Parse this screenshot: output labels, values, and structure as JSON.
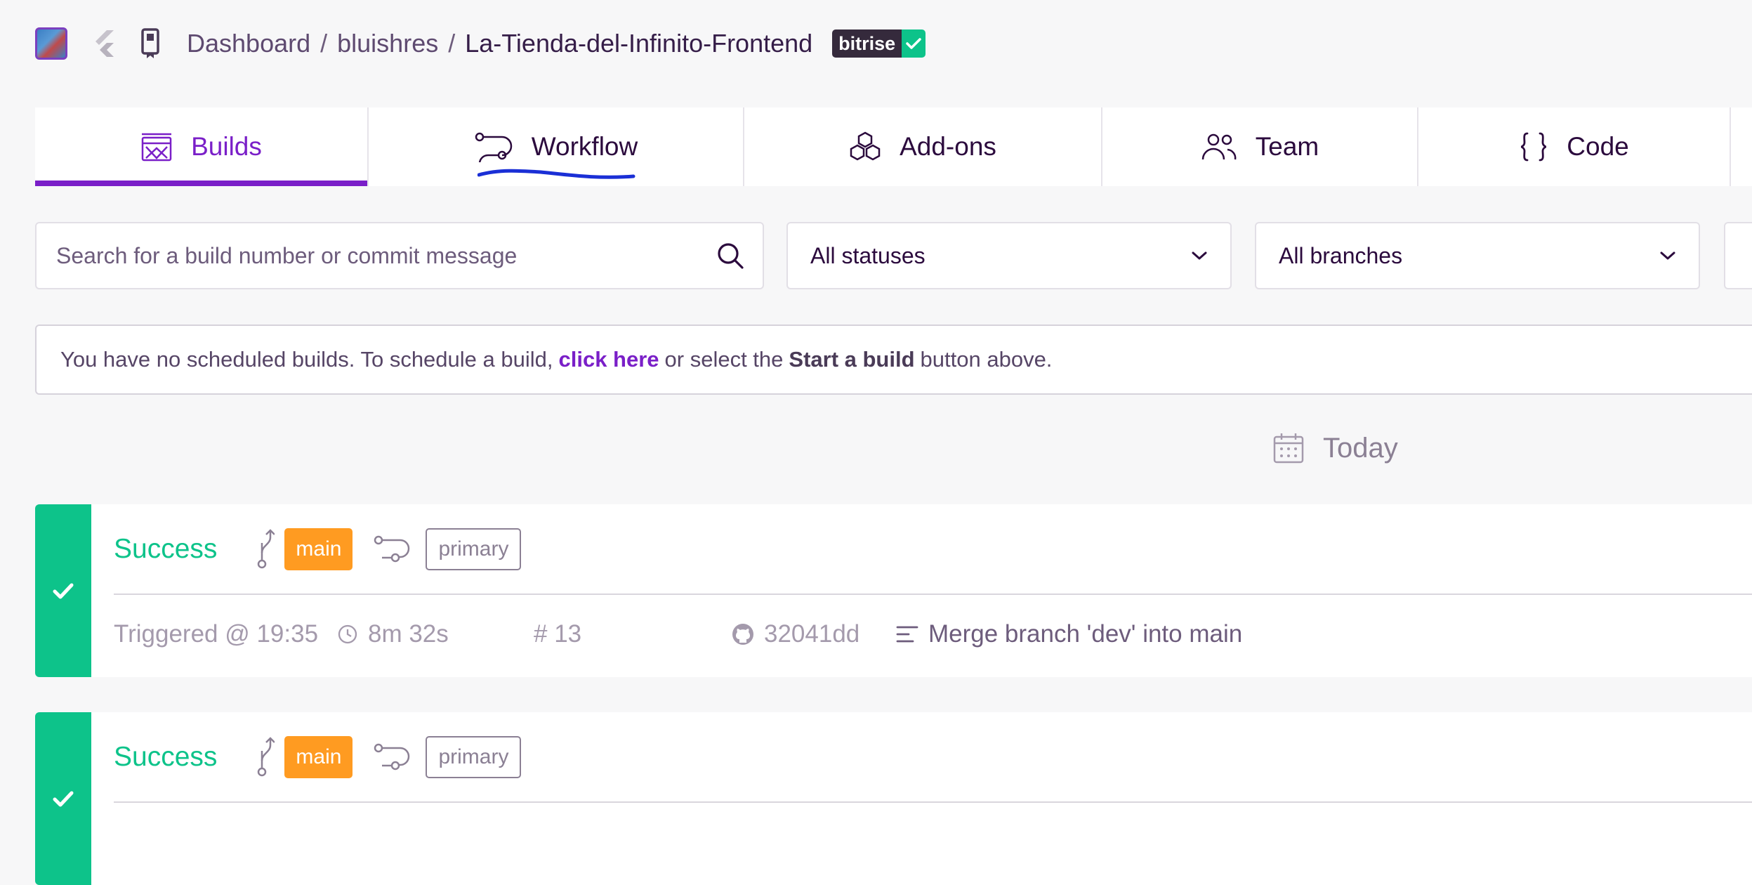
{
  "header": {
    "breadcrumb": {
      "dashboard": "Dashboard",
      "separator": "/",
      "owner": "bluishres",
      "app": "La-Tienda-del-Infinito-Frontend"
    },
    "badge": {
      "label": "bitrise",
      "icon": "check-icon"
    },
    "icons": [
      "app-avatar",
      "flutter-icon",
      "device-icon"
    ]
  },
  "tabs": [
    {
      "label": "Builds",
      "icon": "builds-icon",
      "active": true
    },
    {
      "label": "Workflow",
      "icon": "workflow-icon",
      "active": false
    },
    {
      "label": "Add-ons",
      "icon": "addons-icon",
      "active": false
    },
    {
      "label": "Team",
      "icon": "team-icon",
      "active": false
    },
    {
      "label": "Code",
      "icon": "code-icon",
      "active": false
    }
  ],
  "filters": {
    "search_placeholder": "Search for a build number or commit message",
    "status_select": "All statuses",
    "branch_select": "All branches"
  },
  "notice": {
    "prefix": "You have no scheduled builds. To schedule a build,",
    "link": "click here",
    "middle": "or select the",
    "bold": "Start a build",
    "suffix": "button above."
  },
  "date_group": "Today",
  "builds": [
    {
      "status": "Success",
      "branch": "main",
      "workflow": "primary",
      "triggered": "Triggered @ 19:35",
      "duration": "8m 32s",
      "number": "# 13",
      "commit": "32041dd",
      "message": "Merge branch 'dev' into main"
    },
    {
      "status": "Success",
      "branch": "main",
      "workflow": "primary"
    }
  ],
  "colors": {
    "accent": "#7a1fc8",
    "success": "#0dc38a",
    "branch": "#ff9b21",
    "annotation": "#1a2fd6"
  }
}
